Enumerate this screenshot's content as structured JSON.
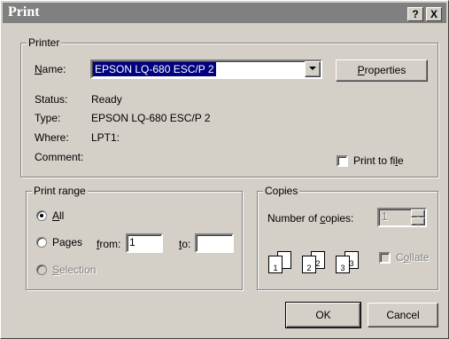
{
  "window": {
    "title": "Print",
    "help_label": "?",
    "close_label": "X"
  },
  "printer": {
    "legend": "Printer",
    "name_label": "Name:",
    "name_value": "EPSON LQ-680 ESC/P 2",
    "properties_label": "Properties",
    "status_label": "Status:",
    "status_value": "Ready",
    "type_label": "Type:",
    "type_value": "EPSON LQ-680 ESC/P 2",
    "where_label": "Where:",
    "where_value": "LPT1:",
    "comment_label": "Comment:",
    "comment_value": "",
    "print_to_file_label": "Print to file",
    "print_to_file_checked": false
  },
  "print_range": {
    "legend": "Print range",
    "all_label": "All",
    "all_selected": true,
    "pages_label": "Pages",
    "from_label": "from:",
    "from_value": "1",
    "to_label": "to:",
    "to_value": "",
    "selection_label": "Selection",
    "selection_enabled": false
  },
  "copies": {
    "legend": "Copies",
    "number_label": "Number of copies:",
    "number_value": "1",
    "collate_label": "Collate",
    "collate_enabled": false,
    "pages_icons": [
      [
        "1",
        "1"
      ],
      [
        "2",
        "2"
      ],
      [
        "3",
        "3"
      ]
    ]
  },
  "buttons": {
    "ok_label": "OK",
    "cancel_label": "Cancel"
  }
}
